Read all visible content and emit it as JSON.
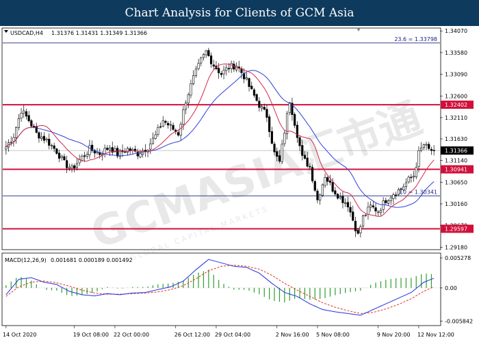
{
  "banner": {
    "title": "Chart Analysis for Clients of GCM Asia"
  },
  "chart_info": {
    "symbol": "USDCAD,H4",
    "ohlc": "1.31376 1.31431 1.31349 1.31366"
  },
  "macd_info": {
    "label": "MACD(12,26,9)",
    "values": "0.001681 0.000189 0.001492"
  },
  "watermark": {
    "text": "GCMASIA汇市通",
    "subtext": "GLOBAL CAPITAL MARKETS"
  },
  "colors": {
    "candle": "#000000",
    "ma_fast": "#d0284a",
    "ma_slow": "#2c3ed6",
    "level_line": "#d0103a",
    "fib_line": "#1a237e",
    "macd_hist": "#2e9d2e",
    "macd_signal": "#e03020",
    "macd_line": "#2030e0",
    "current_price": "#000000"
  },
  "chart_data": {
    "type": "candlestick",
    "title": "USDCAD,H4",
    "ylim": [
      1.2914,
      1.3412
    ],
    "price_axis_ticks": [
      "1.34070",
      "1.33580",
      "1.33090",
      "1.32600",
      "1.32110",
      "1.31630",
      "1.31140",
      "1.30650",
      "1.30160",
      "1.29670",
      "1.29180"
    ],
    "price_axis_values": [
      1.3407,
      1.3358,
      1.3309,
      1.326,
      1.3211,
      1.3163,
      1.3114,
      1.3065,
      1.3016,
      1.2967,
      1.2918
    ],
    "x_ticks": [
      "14 Oct 2020",
      "19 Oct 08:00",
      "22 Oct 00:00",
      "26 Oct 12:00",
      "29 Oct 04:00",
      "2 Nov 16:00",
      "5 Nov 08:00",
      "9 Nov 20:00",
      "12 Nov 12:00"
    ],
    "x_tick_index": [
      0,
      27,
      43,
      67,
      83,
      107,
      123,
      147,
      163
    ],
    "bar_count": 170,
    "close_anchors": [
      [
        0,
        1.3145
      ],
      [
        3,
        1.317
      ],
      [
        6,
        1.3228
      ],
      [
        9,
        1.3205
      ],
      [
        12,
        1.3175
      ],
      [
        16,
        1.316
      ],
      [
        20,
        1.3135
      ],
      [
        23,
        1.3108
      ],
      [
        26,
        1.3095
      ],
      [
        29,
        1.3115
      ],
      [
        33,
        1.314
      ],
      [
        37,
        1.313
      ],
      [
        41,
        1.3145
      ],
      [
        44,
        1.3128
      ],
      [
        48,
        1.314
      ],
      [
        52,
        1.313
      ],
      [
        56,
        1.3145
      ],
      [
        59,
        1.317
      ],
      [
        62,
        1.3205
      ],
      [
        65,
        1.319
      ],
      [
        68,
        1.3175
      ],
      [
        71,
        1.325
      ],
      [
        74,
        1.33
      ],
      [
        77,
        1.334
      ],
      [
        79,
        1.336
      ],
      [
        82,
        1.333
      ],
      [
        85,
        1.331
      ],
      [
        88,
        1.3325
      ],
      [
        91,
        1.333
      ],
      [
        94,
        1.3305
      ],
      [
        97,
        1.327
      ],
      [
        100,
        1.324
      ],
      [
        103,
        1.3215
      ],
      [
        106,
        1.313
      ],
      [
        108,
        1.311
      ],
      [
        110,
        1.318
      ],
      [
        112,
        1.325
      ],
      [
        114,
        1.32
      ],
      [
        117,
        1.312
      ],
      [
        120,
        1.31
      ],
      [
        123,
        1.3025
      ],
      [
        126,
        1.308
      ],
      [
        129,
        1.305
      ],
      [
        132,
        1.303
      ],
      [
        135,
        1.3015
      ],
      [
        137,
        1.298
      ],
      [
        139,
        1.2945
      ],
      [
        141,
        1.2985
      ],
      [
        144,
        1.301
      ],
      [
        147,
        1.3
      ],
      [
        150,
        1.3025
      ],
      [
        153,
        1.304
      ],
      [
        156,
        1.305
      ],
      [
        159,
        1.307
      ],
      [
        161,
        1.308
      ],
      [
        163,
        1.313
      ],
      [
        165,
        1.315
      ],
      [
        167,
        1.3138
      ],
      [
        169,
        1.31366
      ]
    ],
    "last_close": 1.31366,
    "moving_averages": [
      {
        "type": "fast",
        "color": "#d0284a"
      },
      {
        "type": "slow",
        "color": "#2c3ed6"
      }
    ],
    "horizontal_levels": [
      {
        "value": 1.32402,
        "label": "1.32402",
        "kind": "resistance"
      },
      {
        "value": 1.30941,
        "label": "1.30941",
        "kind": "support"
      },
      {
        "value": 1.29597,
        "label": "1.29597",
        "kind": "support"
      }
    ],
    "fib_levels": [
      {
        "value": 1.33798,
        "label": "23.6 = 1.33798"
      },
      {
        "value": 1.30341,
        "label": "0.0 = 1.30341"
      }
    ],
    "current_price_label": "1.31366",
    "macd": {
      "params": "12,26,9",
      "ylim": [
        -0.0065,
        0.006
      ],
      "axis_ticks": [
        "0.005278",
        "0.00",
        "-0.005842"
      ],
      "axis_values": [
        0.005278,
        0.0,
        -0.005842
      ],
      "main_anchors": [
        [
          0,
          -0.0012
        ],
        [
          5,
          0.0015
        ],
        [
          10,
          0.0018
        ],
        [
          15,
          0.001
        ],
        [
          20,
          0.0006
        ],
        [
          25,
          -0.0006
        ],
        [
          30,
          -0.0012
        ],
        [
          35,
          -0.0014
        ],
        [
          40,
          -0.001
        ],
        [
          45,
          -0.0012
        ],
        [
          50,
          -0.0009
        ],
        [
          55,
          -0.0008
        ],
        [
          60,
          -0.0003
        ],
        [
          65,
          0.0002
        ],
        [
          70,
          0.0012
        ],
        [
          75,
          0.0032
        ],
        [
          80,
          0.005
        ],
        [
          85,
          0.0044
        ],
        [
          90,
          0.0038
        ],
        [
          95,
          0.0036
        ],
        [
          100,
          0.0026
        ],
        [
          105,
          0.0008
        ],
        [
          110,
          -0.0008
        ],
        [
          115,
          -0.0015
        ],
        [
          120,
          -0.0028
        ],
        [
          125,
          -0.0038
        ],
        [
          130,
          -0.0042
        ],
        [
          135,
          -0.0045
        ],
        [
          140,
          -0.0048
        ],
        [
          145,
          -0.0038
        ],
        [
          150,
          -0.0028
        ],
        [
          155,
          -0.0018
        ],
        [
          160,
          -0.0008
        ],
        [
          165,
          0.001
        ],
        [
          169,
          0.0017
        ]
      ],
      "signal_anchors": [
        [
          0,
          -0.0015
        ],
        [
          5,
          0.0002
        ],
        [
          10,
          0.001
        ],
        [
          15,
          0.0012
        ],
        [
          20,
          0.0009
        ],
        [
          25,
          0.0003
        ],
        [
          30,
          -0.0004
        ],
        [
          35,
          -0.0009
        ],
        [
          40,
          -0.0011
        ],
        [
          45,
          -0.0011
        ],
        [
          50,
          -0.001
        ],
        [
          55,
          -0.0009
        ],
        [
          60,
          -0.0007
        ],
        [
          65,
          -0.0003
        ],
        [
          70,
          0.0004
        ],
        [
          75,
          0.0016
        ],
        [
          80,
          0.003
        ],
        [
          85,
          0.0038
        ],
        [
          90,
          0.004
        ],
        [
          95,
          0.0038
        ],
        [
          100,
          0.0033
        ],
        [
          105,
          0.0022
        ],
        [
          110,
          0.0008
        ],
        [
          115,
          -0.0004
        ],
        [
          120,
          -0.0015
        ],
        [
          125,
          -0.0026
        ],
        [
          130,
          -0.0034
        ],
        [
          135,
          -0.004
        ],
        [
          140,
          -0.0045
        ],
        [
          145,
          -0.0043
        ],
        [
          150,
          -0.0037
        ],
        [
          155,
          -0.0029
        ],
        [
          160,
          -0.0019
        ],
        [
          165,
          -0.0006
        ],
        [
          169,
          0.0002
        ]
      ]
    }
  }
}
